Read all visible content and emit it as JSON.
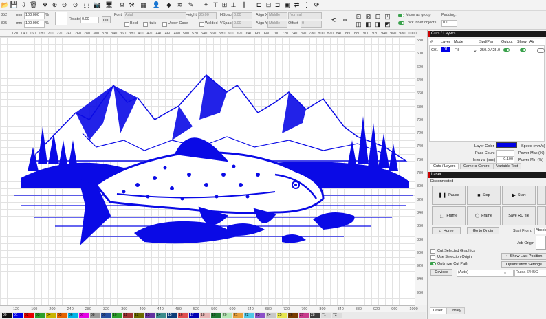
{
  "toolbar": {
    "icons": [
      "open-icon",
      "save-icon",
      "camera-icon",
      "select-icon",
      "user-icon",
      "shapes-icon",
      "star-icon",
      "bell-icon",
      "pen-icon",
      "text-icon",
      "image-icon",
      "trash-icon",
      "move-icon",
      "zoom-in-icon",
      "zoom-out-icon",
      "zoom-window-icon",
      "frame-select-icon",
      "camera-icon",
      "monitor-icon",
      "settings-icon",
      "tools-icon",
      "grid-icon",
      "align-icon",
      "layers-icon",
      "path-icon",
      "target-icon",
      "user-tool-icon",
      "cut-icon",
      "dock-icon",
      "mirror-icon",
      "array-icon",
      "move-laser-icon",
      "align-left-icon",
      "align-center-icon",
      "align-right-icon",
      "distribute-icon",
      "group-icon",
      "rotate-icon",
      "emboss-icon"
    ]
  },
  "position": {
    "x_value": "352",
    "y_value": "805",
    "unit": "mm",
    "width_value": "100.000",
    "height_value": "100.000",
    "percent": "%",
    "rotate_label": "Rotate",
    "rotate_value": "0.00",
    "mm_button": "mm"
  },
  "text_props": {
    "font_label": "Font",
    "font_value": "Arial",
    "height_label": "Height",
    "height_value": "25.00",
    "hspace_label": "HSpace",
    "hspace_value": "0.00",
    "vspace_label": "VSpace",
    "vspace_value": "0.00",
    "align_x_label": "Align X",
    "align_x_value": "Middle",
    "align_y_label": "Align Y",
    "align_y_value": "Middle",
    "style_value": "Normal",
    "offset_label": "Offset",
    "offset_value": "0",
    "bold": "Bold",
    "italic": "Italic",
    "upper_case": "Upper Case",
    "welded": "Welded"
  },
  "move_options": {
    "move_as_group": "Move as group",
    "lock_inner": "Lock inner objects",
    "padding_label": "Padding:",
    "padding_value": "0.0"
  },
  "rulers": {
    "top": [
      "120",
      "140",
      "160",
      "180",
      "200",
      "220",
      "240",
      "260",
      "280",
      "300",
      "320",
      "340",
      "360",
      "380",
      "400",
      "420",
      "440",
      "460",
      "480",
      "500",
      "520",
      "540",
      "560",
      "580",
      "600",
      "620",
      "640",
      "660",
      "680",
      "700",
      "720",
      "740",
      "760",
      "780",
      "800",
      "820",
      "840",
      "860",
      "880",
      "900",
      "920",
      "940",
      "960",
      "980",
      "1000"
    ],
    "bottom": [
      "120",
      "160",
      "200",
      "240",
      "280",
      "320",
      "360",
      "400",
      "440",
      "480",
      "520",
      "560",
      "600",
      "640",
      "680",
      "720",
      "760",
      "800",
      "840",
      "880",
      "920",
      "960",
      "1000"
    ],
    "side": [
      "580",
      "600",
      "620",
      "640",
      "660",
      "680",
      "700",
      "720",
      "740",
      "760",
      "780",
      "800",
      "820",
      "840",
      "860",
      "880",
      "900",
      "920",
      "940",
      "960"
    ]
  },
  "palette": [
    {
      "label": "00",
      "color": "#111111"
    },
    {
      "label": "01",
      "color": "#0000e6"
    },
    {
      "label": "02",
      "color": "#e60000"
    },
    {
      "label": "03",
      "color": "#2ca02c"
    },
    {
      "label": "04",
      "color": "#c8b400"
    },
    {
      "label": "05",
      "color": "#e66400"
    },
    {
      "label": "06",
      "color": "#00b4e6"
    },
    {
      "label": "07",
      "color": "#e600e6"
    },
    {
      "label": "08",
      "color": "#999999"
    },
    {
      "label": "09",
      "color": "#2850a0"
    },
    {
      "label": "10",
      "color": "#2ca02c"
    },
    {
      "label": "11",
      "color": "#a03232"
    },
    {
      "label": "12",
      "color": "#6b6b00"
    },
    {
      "label": "13",
      "color": "#6432a0"
    },
    {
      "label": "14",
      "color": "#3c8c8c"
    },
    {
      "label": "15",
      "color": "#0b3c78"
    },
    {
      "label": "16",
      "color": "#e05050"
    },
    {
      "label": "17",
      "color": "#0000b4"
    },
    {
      "label": "18",
      "color": "#e6b4b4"
    },
    {
      "label": "19",
      "color": "#1e7832"
    },
    {
      "label": "20",
      "color": "#b4e6b4"
    },
    {
      "label": "21",
      "color": "#e6a03c"
    },
    {
      "label": "22",
      "color": "#50c8e6"
    },
    {
      "label": "23",
      "color": "#8c50c8"
    },
    {
      "label": "24",
      "color": "#c8c8c8"
    },
    {
      "label": "25",
      "color": "#e6e650"
    },
    {
      "label": "26",
      "color": "#783c00"
    },
    {
      "label": "27",
      "color": "#c83c8c"
    },
    {
      "label": "28",
      "color": "#3c3c3c"
    },
    {
      "label": "T1",
      "color": "#dcdcdc"
    },
    {
      "label": "T2",
      "color": "#dcdcdc"
    }
  ],
  "cuts_layers": {
    "title": "Cuts / Layers",
    "headers": [
      "#",
      "Layer",
      "Mode",
      "Spd/Pwr",
      "Output",
      "Show",
      "Air"
    ],
    "row": {
      "num": "C01",
      "layer": "01",
      "mode": "Fill",
      "spd_pwr": "250.0 / 25.0"
    },
    "layer_color_label": "Layer Color",
    "layer_color": "#0000e6",
    "speed_label": "Speed (mm/s)",
    "pass_count_label": "Pass Count",
    "pass_count_value": "1",
    "max_power_label": "Power Max (%)",
    "interval_label": "Interval (mm)",
    "interval_value": "0.100",
    "min_power_label": "Power Min (%)",
    "tabs": [
      "Cuts / Layers",
      "Camera Control",
      "Variable Text"
    ]
  },
  "laser": {
    "title": "Laser",
    "status": "Disconnected",
    "buttons": {
      "pause": "Pause",
      "stop": "Stop",
      "start": "Start",
      "frame1": "Frame",
      "frame2": "Frame",
      "save_rd": "Save RD file",
      "home": "Home",
      "go_origin": "Go to Origin"
    },
    "start_from_label": "Start From:",
    "start_from_value": "Absolute",
    "job_origin_label": "Job Origin",
    "cut_selected": "Cut Selected Graphics",
    "use_selection_origin": "Use Selection Origin",
    "optimize_cut_path": "Optimize Cut Path",
    "show_last_position": "Show Last Position",
    "optimization_settings": "Optimization Settings",
    "devices": "Devices",
    "device_value": "(Auto)",
    "controller": "Ruida 6445G",
    "bottom_tabs": [
      "Laser",
      "Library"
    ]
  }
}
